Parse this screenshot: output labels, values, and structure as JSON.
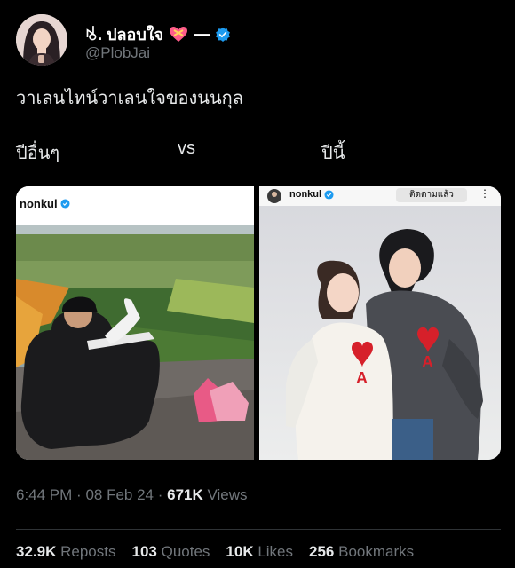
{
  "author": {
    "display_name": "ꂚ. ปลอบใจ",
    "display_suffix": "—",
    "handle": "@PlobJai"
  },
  "tweet": {
    "text": "วาเลนไทน์วาเลนใจของนนกุล",
    "label_left": "ปีอื่นๆ",
    "label_vs": "vs",
    "label_right": "ปีนี้"
  },
  "media": {
    "left_panel": {
      "username": "nonkul"
    },
    "right_panel": {
      "username": "nonkul",
      "button_label": "ติดตามแล้ว"
    }
  },
  "meta": {
    "time": "6:44 PM",
    "date": "08 Feb 24",
    "views_count": "671K",
    "views_label": "Views"
  },
  "stats": {
    "reposts_count": "32.9K",
    "reposts_label": "Reposts",
    "quotes_count": "103",
    "quotes_label": "Quotes",
    "likes_count": "10K",
    "likes_label": "Likes",
    "bookmarks_count": "256",
    "bookmarks_label": "Bookmarks"
  },
  "colors": {
    "background": "#000000",
    "text_primary": "#e7e9ea",
    "text_secondary": "#71767b",
    "verified": "#1d9bf0",
    "heart_emoji": "#ff5c8a"
  }
}
